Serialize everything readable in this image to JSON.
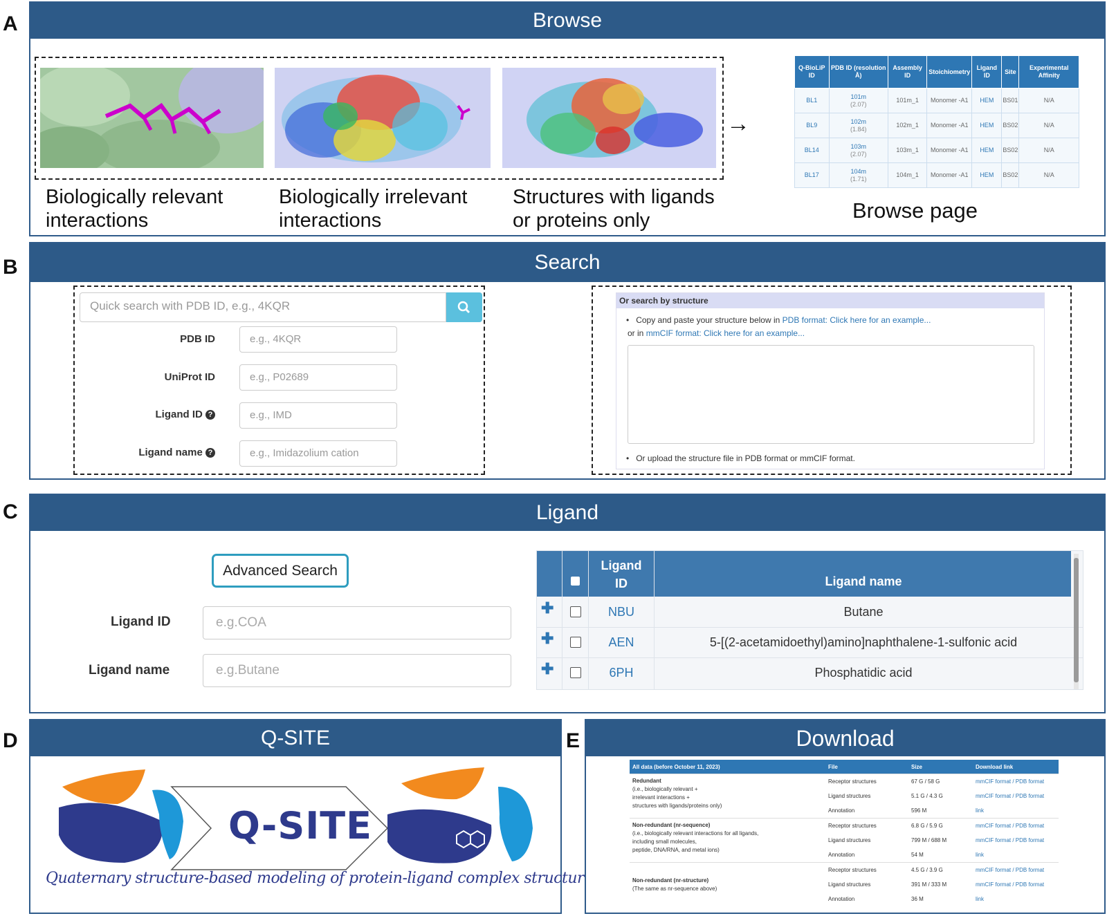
{
  "panels": {
    "a": {
      "letter": "A",
      "title": "Browse"
    },
    "b": {
      "letter": "B",
      "title": "Search"
    },
    "c": {
      "letter": "C",
      "title": "Ligand"
    },
    "d": {
      "letter": "D",
      "title": "Q-SITE"
    },
    "e": {
      "letter": "E",
      "title": "Download"
    }
  },
  "browse": {
    "captions": [
      {
        "line1": "Biologically relevant",
        "line2": "interactions"
      },
      {
        "line1": "Biologically irrelevant",
        "line2": "interactions"
      },
      {
        "line1": "Structures with ligands",
        "line2": "or proteins only"
      }
    ],
    "arrow": "→",
    "page_caption": "Browse page",
    "table": {
      "headers": [
        "Q-BioLiP ID",
        "PDB ID (resolution Å)",
        "Assembly ID",
        "Stoichiometry",
        "Ligand ID",
        "Site",
        "Experimental Affinity"
      ],
      "rows": [
        {
          "id": "BL1",
          "pdb": "101m",
          "res": "(2.07)",
          "asm": "101m_1",
          "sto": "Monomer -A1",
          "lig": "HEM",
          "site": "BS01",
          "aff": "N/A"
        },
        {
          "id": "BL9",
          "pdb": "102m",
          "res": "(1.84)",
          "asm": "102m_1",
          "sto": "Monomer -A1",
          "lig": "HEM",
          "site": "BS02",
          "aff": "N/A"
        },
        {
          "id": "BL14",
          "pdb": "103m",
          "res": "(2.07)",
          "asm": "103m_1",
          "sto": "Monomer -A1",
          "lig": "HEM",
          "site": "BS02",
          "aff": "N/A"
        },
        {
          "id": "BL17",
          "pdb": "104m",
          "res": "(1.71)",
          "asm": "104m_1",
          "sto": "Monomer -A1",
          "lig": "HEM",
          "site": "BS02",
          "aff": "N/A"
        }
      ]
    }
  },
  "search": {
    "quick_placeholder": "Quick search with PDB ID, e.g., 4KQR",
    "fields": [
      {
        "label": "PDB ID",
        "placeholder": "e.g., 4KQR"
      },
      {
        "label": "UniProt ID",
        "placeholder": "e.g., P02689"
      },
      {
        "label": "Ligand ID",
        "placeholder": "e.g., IMD"
      },
      {
        "label": "Ligand name",
        "placeholder": "e.g., Imidazolium cation"
      }
    ],
    "help_glyph": "?",
    "structure": {
      "header": "Or search by structure",
      "line1_prefix": "Copy and paste your structure below in ",
      "line1_link": "PDB format: Click here for an example...",
      "line2_prefix": "or in ",
      "line2_link": "mmCIF format: Click here for an example...",
      "upload_text": "Or upload the structure file in PDB format or mmCIF format."
    }
  },
  "ligand": {
    "advanced_button": "Advanced Search",
    "id_label": "Ligand ID",
    "id_placeholder": "e.g.COA",
    "name_label": "Ligand name",
    "name_placeholder": "e.g.Butane",
    "table": {
      "col_id_line1": "Ligand",
      "col_id_line2": "ID",
      "col_name": "Ligand name",
      "rows": [
        {
          "id": "NBU",
          "name": "Butane"
        },
        {
          "id": "AEN",
          "name": "5-[(2-acetamidoethyl)amino]naphthalene-1-sulfonic acid"
        },
        {
          "id": "6PH",
          "name": "Phosphatidic acid"
        }
      ],
      "expand_glyph": "✚"
    }
  },
  "qsite": {
    "logo_text": "Q-SITE",
    "tagline": "Quaternary structure-based modeling of protein-ligand complex structure"
  },
  "download": {
    "headers": [
      "All data (before October 11, 2023)",
      "File",
      "Size",
      "Download link"
    ],
    "groups": [
      {
        "title": "Redundant",
        "desc": [
          "(i.e., biologically relevant +",
          "irrelevant interactions +",
          "structures with ligands/proteins only)"
        ],
        "rows": [
          {
            "file": "Receptor structures",
            "size": "67 G / 58 G",
            "link": "mmCIF format / PDB format"
          },
          {
            "file": "Ligand structures",
            "size": "5.1 G / 4.3 G",
            "link": "mmCIF format / PDB format"
          },
          {
            "file": "Annotation",
            "size": "596 M",
            "link": "link"
          }
        ]
      },
      {
        "title": "Non-redundant (nr-sequence)",
        "desc": [
          "(i.e., biologically relevant interactions for all ligands,",
          "including small molecules,",
          "peptide, DNA/RNA, and metal ions)"
        ],
        "rows": [
          {
            "file": "Receptor structures",
            "size": "6.8 G / 5.9 G",
            "link": "mmCIF format / PDB format"
          },
          {
            "file": "Ligand structures",
            "size": "799 M / 688 M",
            "link": "mmCIF format / PDB format"
          },
          {
            "file": "Annotation",
            "size": "54 M",
            "link": "link"
          }
        ]
      },
      {
        "title": "Non-redundant (nr-structure)",
        "desc": [
          "(The same as nr-sequence above)"
        ],
        "rows": [
          {
            "file": "Receptor structures",
            "size": "4.5 G / 3.9 G",
            "link": "mmCIF format / PDB format"
          },
          {
            "file": "Ligand structures",
            "size": "391 M / 333 M",
            "link": "mmCIF format / PDB format"
          },
          {
            "file": "Annotation",
            "size": "36 M",
            "link": "link"
          }
        ]
      }
    ]
  },
  "colors": {
    "header_blue": "#2d5a88",
    "table_blue": "#2e77b4",
    "search_button": "#5bc0de",
    "ligand_magenta": "#cc00cc"
  }
}
